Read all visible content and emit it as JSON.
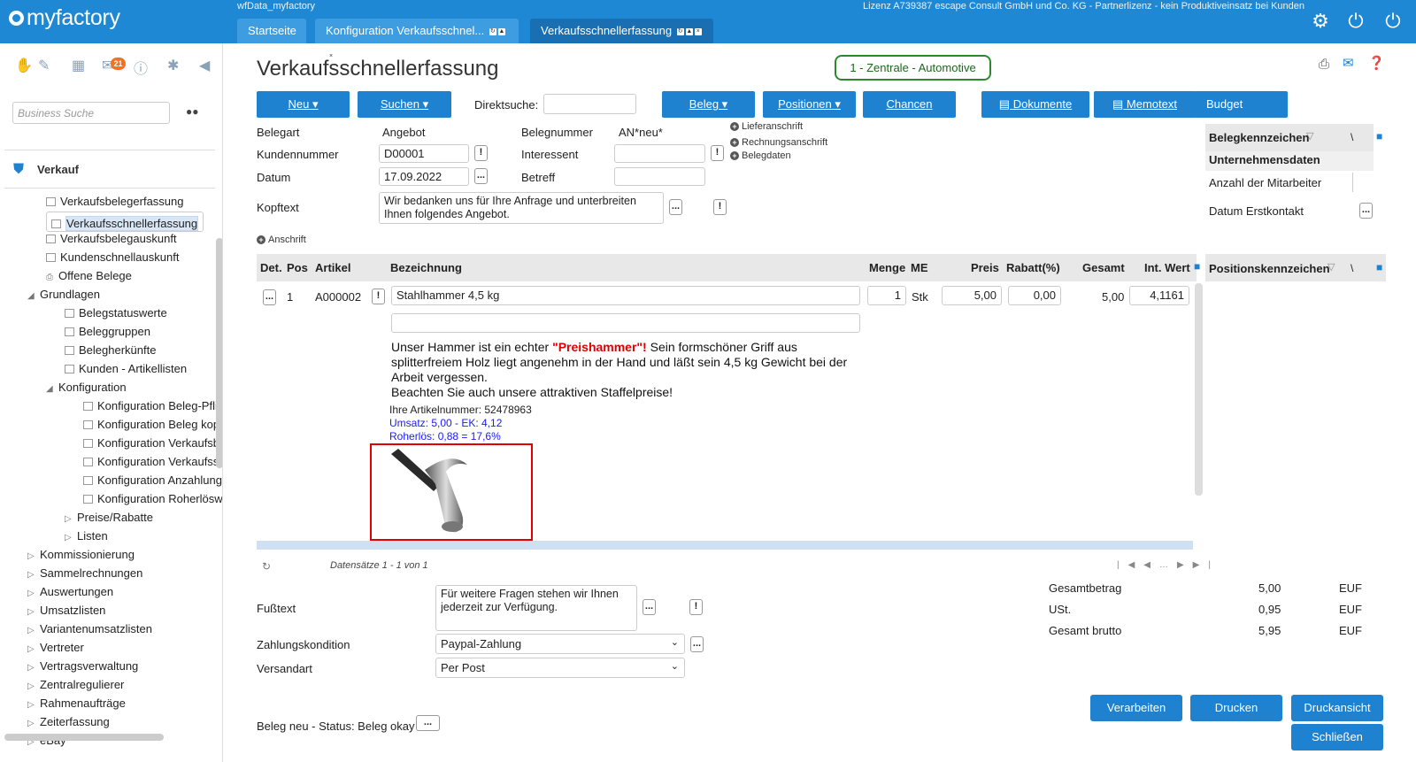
{
  "app": {
    "logo": "myfactory",
    "db_name": "wfData_myfactory",
    "license": "Lizenz A739387 escape Consult GmbH und Co. KG - Partnerlizenz - kein Produktiveinsatz bei Kunden"
  },
  "tabs": [
    {
      "label": "Startseite"
    },
    {
      "label": "Konfiguration Verkaufsschnel..."
    },
    {
      "label": "Verkaufsschnellerfassung"
    }
  ],
  "topicons": [
    "gear-icon",
    "power-icon",
    "logout-power-icon"
  ],
  "sidebar": {
    "notification_count": "21",
    "search_placeholder": "Business Suche",
    "section": "Verkauf",
    "items": [
      "Verkaufsbelegerfassung",
      "Verkaufsschnellerfassung",
      "Verkaufsbelegauskunft",
      "Kundenschnellauskunft",
      "Offene Belege",
      "Grundlagen",
      "Belegstatuswerte",
      "Beleggruppen",
      "Belegherkünfte",
      "Kunden - Artikellisten",
      "Konfiguration",
      "Konfiguration Beleg-Pflichta",
      "Konfiguration Beleg kopiere",
      "Konfiguration Verkaufsbele",
      "Konfiguration Verkaufsschr",
      "Konfiguration Anzahlungsre",
      "Konfiguration Roherlöswarn",
      "Preise/Rabatte",
      "Listen",
      "Kommissionierung",
      "Sammelrechnungen",
      "Auswertungen",
      "Umsatzlisten",
      "Variantenumsatzlisten",
      "Vertreter",
      "Vertragsverwaltung",
      "Zentralregulierer",
      "Rahmenaufträge",
      "Zeiterfassung",
      "eBay"
    ]
  },
  "page": {
    "title": "Verkaufsschnellerfassung",
    "company": "1 - Zentrale - Automotive",
    "buttons": {
      "neu": "Neu",
      "suchen": "Suchen",
      "beleg": "Beleg",
      "positionen": "Positionen",
      "chancen": "Chancen",
      "dokumente": "Dokumente",
      "memotext": "Memotext",
      "budget": "Budget"
    },
    "direktsuche_label": "Direktsuche:",
    "belegart_label": "Belegart",
    "belegart_value": "Angebot",
    "belegnummer_label": "Belegnummer",
    "belegnummer_value": "AN*neu*",
    "kundennummer_label": "Kundennummer",
    "kundennummer_value": "D00001",
    "interessent_label": "Interessent",
    "datum_label": "Datum",
    "datum_value": "17.09.2022",
    "betreff_label": "Betreff",
    "kopftext_label": "Kopftext",
    "kopftext_value": "Wir bedanken uns für Ihre Anfrage und unterbreiten Ihnen folgendes Angebot.",
    "links": {
      "lieferanschrift": "Lieferanschrift",
      "rechnungsanschrift": "Rechnungsanschrift",
      "belegdaten": "Belegdaten",
      "anschrift": "Anschrift"
    },
    "right_panel": {
      "header": "Belegkennzeichen",
      "group": "Unternehmensdaten",
      "item1": "Anzahl der Mitarbeiter",
      "item2": "Datum Erstkontakt",
      "pos_header": "Positionskennzeichen"
    },
    "grid": {
      "columns": [
        "Det.",
        "Pos",
        "Artikel",
        "Bezeichnung",
        "Menge",
        "ME",
        "Preis",
        "Rabatt(%)",
        "Gesamt",
        "Int. Wert"
      ],
      "row": {
        "pos": "1",
        "artikel": "A000002",
        "bezeichnung": "Stahlhammer 4,5 kg",
        "menge": "1",
        "me": "Stk",
        "preis": "5,00",
        "rabatt": "0,00",
        "gesamt": "5,00",
        "intwert": "4,1161"
      },
      "desc_pre": "Unser Hammer ist ein echter ",
      "desc_bold": "\"Preishammer\"!",
      "desc_post": " Sein formschöner Griff aus splitterfreiem Holz liegt angenehm in der Hand und läßt sein 4,5 kg Gewicht bei der Arbeit vergessen.",
      "desc_line2": "Beachten Sie auch unsere attraktiven Staffelpreise!",
      "artnr": "Ihre Artikelnummer: 52478963",
      "umsatz": "Umsatz: 5,00 - EK: 4,12",
      "roherloes": "Roherlös: 0,88 = 17,6%",
      "records": "Datensätze 1 - 1 von 1"
    },
    "fusstext_label": "Fußtext",
    "fusstext_value": "Für weitere Fragen stehen wir Ihnen jederzeit zur Verfügung.",
    "zahlung_label": "Zahlungskondition",
    "zahlung_value": "Paypal-Zahlung",
    "versand_label": "Versandart",
    "versand_value": "Per Post",
    "status": "Beleg neu - Status: Beleg okay",
    "totals": [
      {
        "label": "Gesamtbetrag",
        "value": "5,00",
        "cur": "EUF"
      },
      {
        "label": "USt.",
        "value": "0,95",
        "cur": "EUF"
      },
      {
        "label": "Gesamt brutto",
        "value": "5,95",
        "cur": "EUF"
      }
    ],
    "actions": {
      "verarbeiten": "Verarbeiten",
      "drucken": "Drucken",
      "druckansicht": "Druckansicht",
      "schliessen": "Schließen"
    }
  }
}
